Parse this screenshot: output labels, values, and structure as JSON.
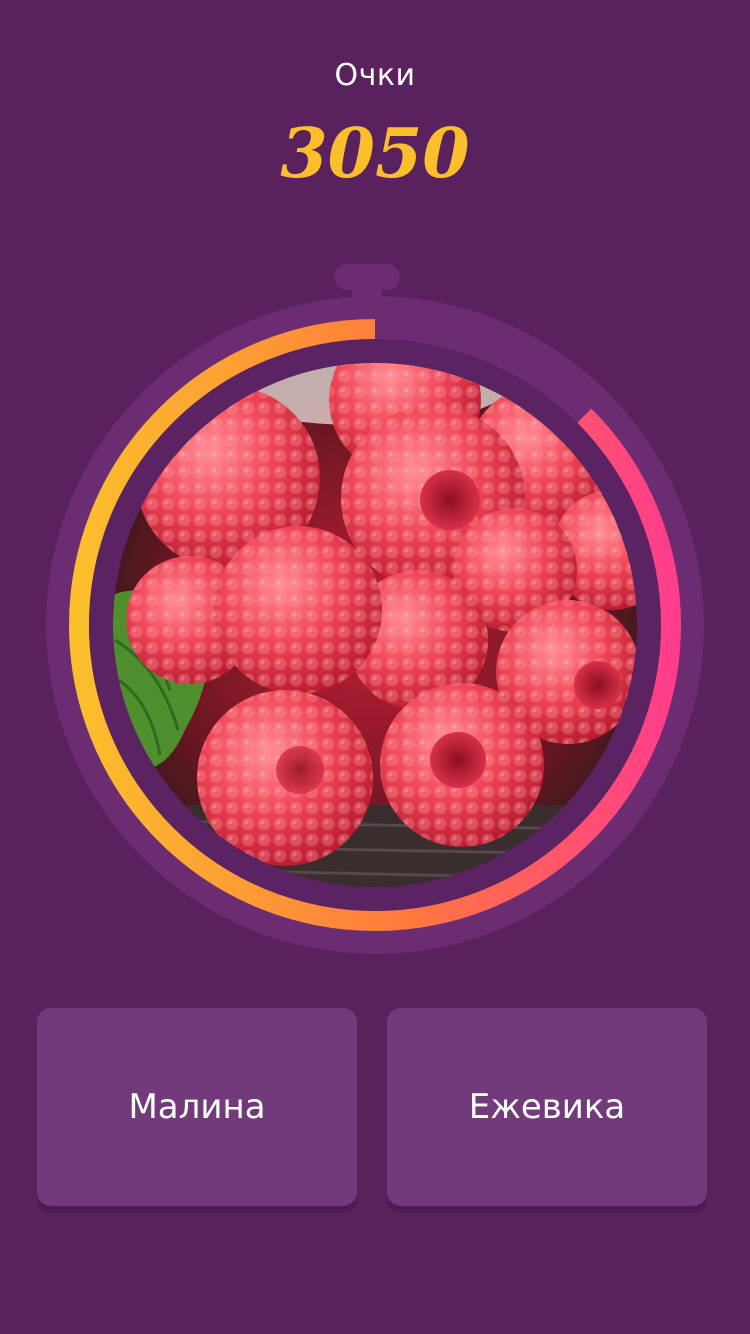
{
  "score": {
    "label": "Очки",
    "value": "3050"
  },
  "timer": {
    "remaining_fraction": 0.875,
    "gradient_colors": [
      "#fbbf2c",
      "#ff7a3d",
      "#ff3d8b"
    ],
    "image_subject": "raspberries-photo"
  },
  "answers": [
    {
      "label": "Малина"
    },
    {
      "label": "Ежевика"
    }
  ],
  "colors": {
    "background": "#59215d",
    "accent": "#fbbf2c",
    "button": "#723a7a"
  }
}
